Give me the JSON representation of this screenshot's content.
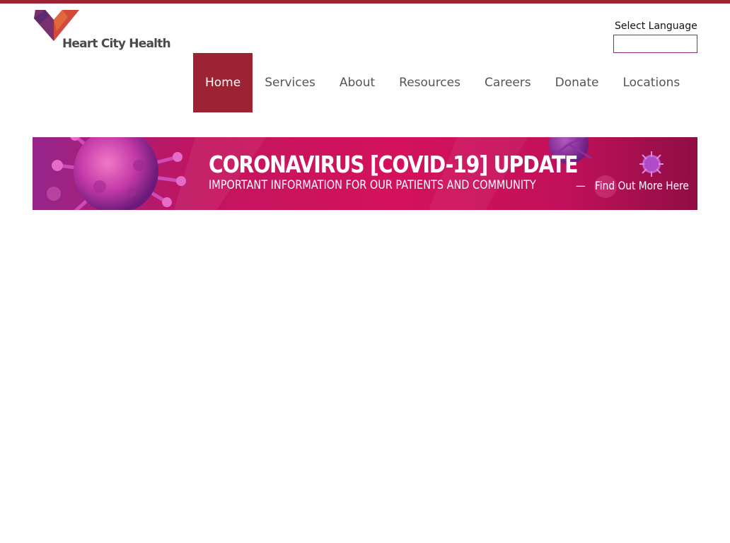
{
  "colors": {
    "brand": "#9b2333",
    "banner_magenta": "#c8145e",
    "select_border": "#8e2a7a"
  },
  "logo": {
    "text": "Heart City Health",
    "icon": "heart-logo-icon"
  },
  "language": {
    "label": "Select Language",
    "selected_value": ""
  },
  "nav": {
    "items": [
      {
        "label": "Home",
        "active": true
      },
      {
        "label": "Services",
        "active": false
      },
      {
        "label": "About",
        "active": false
      },
      {
        "label": "Resources",
        "active": false
      },
      {
        "label": "Careers",
        "active": false
      },
      {
        "label": "Donate",
        "active": false
      },
      {
        "label": "Locations",
        "active": false
      }
    ]
  },
  "banner": {
    "title": "CORONAVIRUS [COVID-19] UPDATE",
    "subtitle": "IMPORTANT INFORMATION FOR OUR PATIENTS AND COMMUNITY",
    "separator": "—",
    "link_text": "Find Out More Here",
    "image_icon": "virus-illustration-icon"
  }
}
